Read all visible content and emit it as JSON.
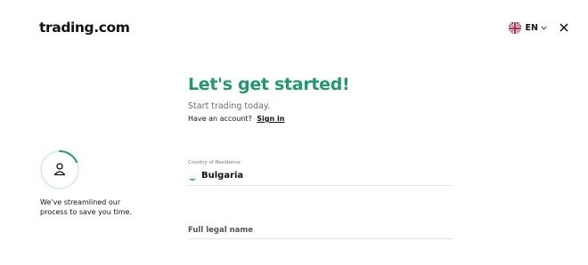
{
  "header": {
    "logo_text": "trading.com",
    "language": {
      "code": "EN",
      "flag_icon": "uk-flag-icon"
    },
    "close_icon": "close-icon"
  },
  "main": {
    "title": "Let's get started!",
    "subtitle": "Start trading today.",
    "account_prompt": "Have an account?",
    "sign_in_label": "Sign in"
  },
  "side": {
    "progress_fraction": 0.18,
    "icon": "user-icon",
    "line1": "We've streamlined our",
    "line2": "process to save you time."
  },
  "form": {
    "country": {
      "label": "Country of Residence",
      "value": "Bulgaria",
      "flag_icon": "bulgaria-flag-icon"
    },
    "full_name": {
      "placeholder": "Full legal name",
      "value": ""
    }
  },
  "colors": {
    "accent": "#1f9a6b",
    "progress_track": "#cfeee0",
    "divider": "#e3e3e3"
  }
}
